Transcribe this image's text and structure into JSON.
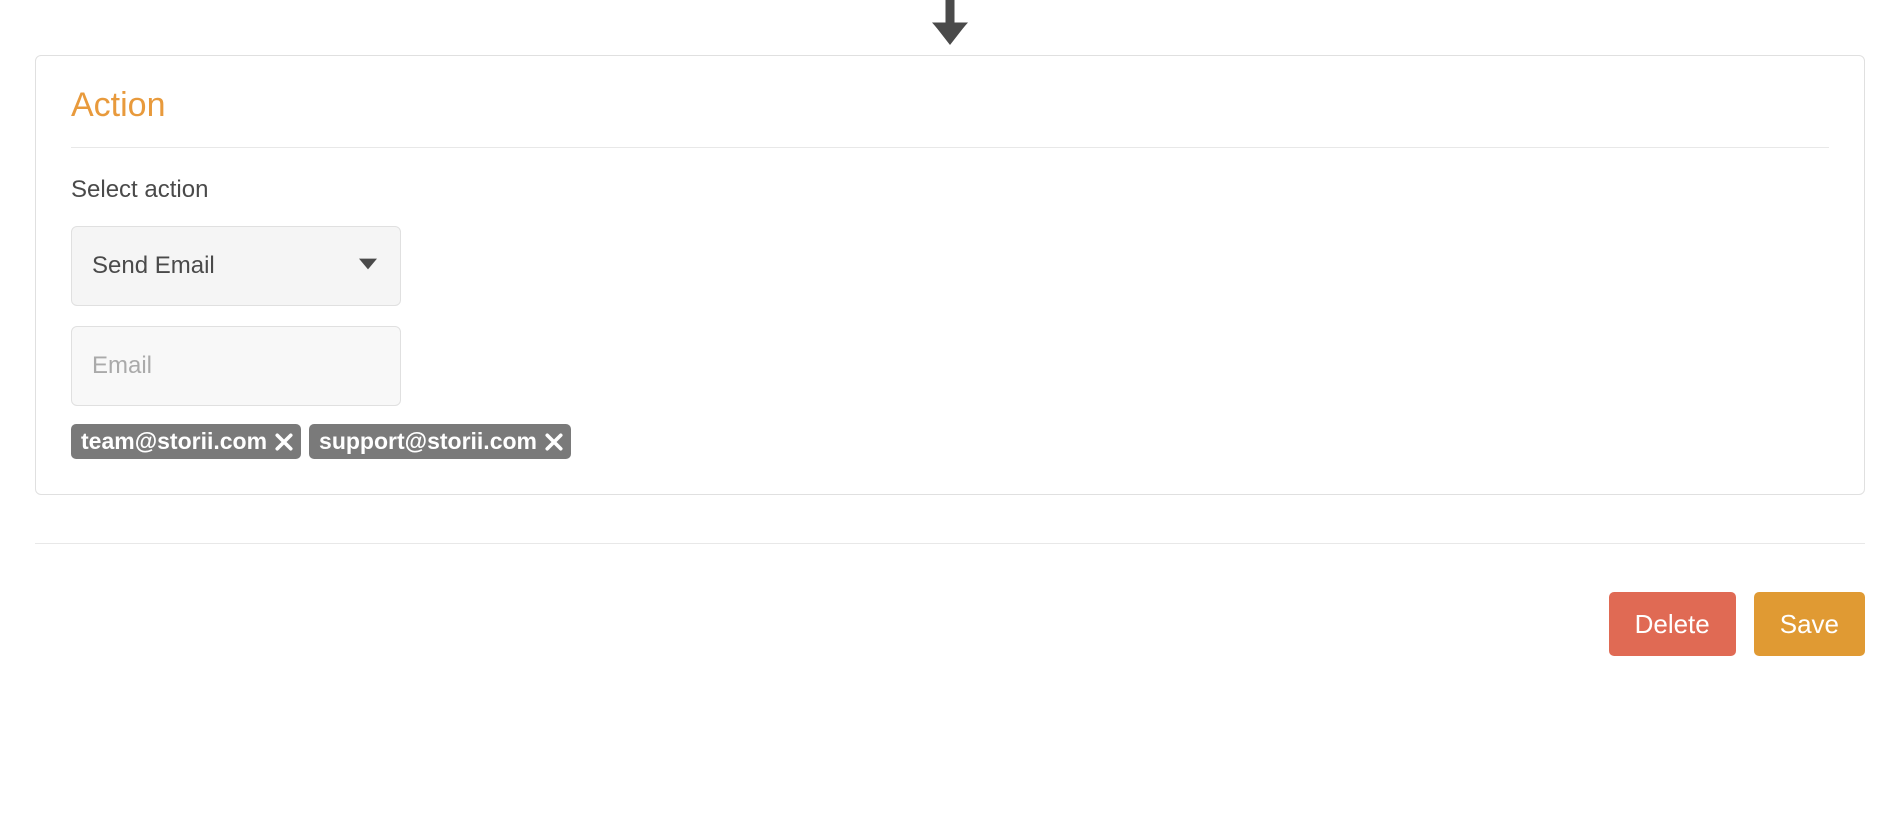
{
  "arrow_icon": "arrow-down",
  "action": {
    "title": "Action",
    "select_label": "Select action",
    "selected_value": "Send Email",
    "email_placeholder": "Email",
    "email_value": "",
    "chips": [
      "team@storii.com",
      "support@storii.com"
    ]
  },
  "footer": {
    "delete_label": "Delete",
    "save_label": "Save"
  },
  "colors": {
    "accent_orange": "#e89a3c",
    "button_orange": "#e09a33",
    "button_red": "#e06a54",
    "chip_gray": "#7a7a7a",
    "text_dark": "#4a4a4a",
    "border": "#e0e0e0"
  }
}
